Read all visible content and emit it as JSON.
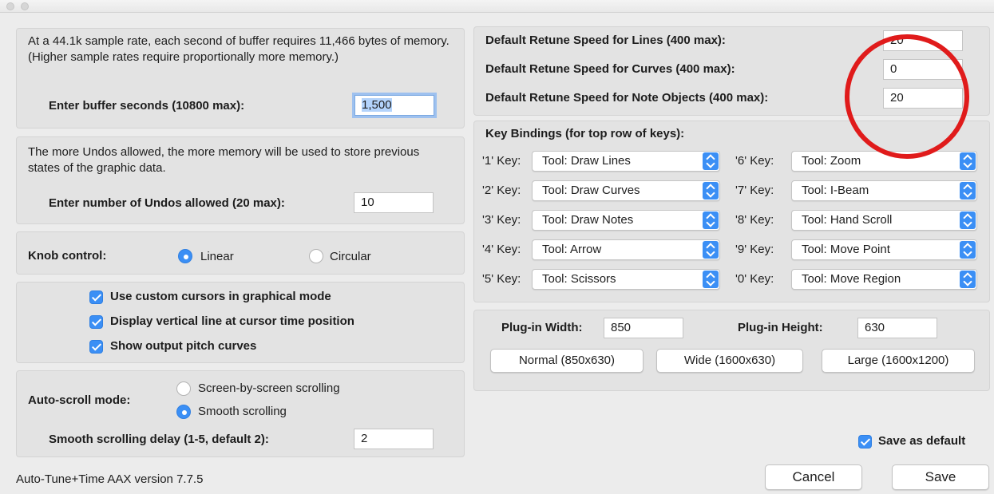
{
  "buffer": {
    "description": "At a 44.1k sample rate, each second of buffer requires 11,466 bytes of memory. (Higher sample rates require proportionally more memory.)",
    "label": "Enter buffer seconds (10800 max):",
    "value": "1,500"
  },
  "undos": {
    "description": "The more Undos allowed, the more memory will be used to store previous states of the graphic data.",
    "label": "Enter number of Undos allowed (20 max):",
    "value": "10"
  },
  "knob": {
    "label": "Knob control:",
    "option_linear": "Linear",
    "option_circular": "Circular",
    "selected": "Linear"
  },
  "options": {
    "custom_cursors": "Use custom cursors in graphical mode",
    "vertical_line": "Display vertical line at cursor time position",
    "pitch_curves": "Show output pitch curves"
  },
  "autoscroll": {
    "label": "Auto-scroll mode:",
    "option_screen": "Screen-by-screen scrolling",
    "option_smooth": "Smooth scrolling",
    "selected": "Smooth scrolling",
    "delay_label": "Smooth scrolling delay (1-5, default 2):",
    "delay_value": "2"
  },
  "version": "Auto-Tune+Time AAX version 7.7.5",
  "retune": {
    "lines_label": "Default Retune Speed for Lines (400 max):",
    "lines_value": "20",
    "curves_label": "Default Retune Speed for Curves (400 max):",
    "curves_value": "0",
    "notes_label": "Default Retune Speed for Note Objects (400 max):",
    "notes_value": "20"
  },
  "keybindings": {
    "title": "Key Bindings (for top row of keys):",
    "keys": [
      {
        "key": "'1' Key:",
        "tool": "Tool: Draw Lines"
      },
      {
        "key": "'2' Key:",
        "tool": "Tool: Draw Curves"
      },
      {
        "key": "'3' Key:",
        "tool": "Tool: Draw Notes"
      },
      {
        "key": "'4' Key:",
        "tool": "Tool: Arrow"
      },
      {
        "key": "'5' Key:",
        "tool": "Tool: Scissors"
      },
      {
        "key": "'6' Key:",
        "tool": "Tool: Zoom"
      },
      {
        "key": "'7' Key:",
        "tool": "Tool: I-Beam"
      },
      {
        "key": "'8' Key:",
        "tool": "Tool: Hand Scroll"
      },
      {
        "key": "'9' Key:",
        "tool": "Tool: Move Point"
      },
      {
        "key": "'0' Key:",
        "tool": "Tool: Move Region"
      }
    ]
  },
  "plugin": {
    "width_label": "Plug-in Width:",
    "width_value": "850",
    "height_label": "Plug-in Height:",
    "height_value": "630",
    "normal_button": "Normal (850x630)",
    "wide_button": "Wide (1600x630)",
    "large_button": "Large (1600x1200)"
  },
  "save_default": "Save as default",
  "cancel_button": "Cancel",
  "save_button": "Save",
  "colors": {
    "accent": "#3b8ff5",
    "annotation": "#e01b1b"
  }
}
